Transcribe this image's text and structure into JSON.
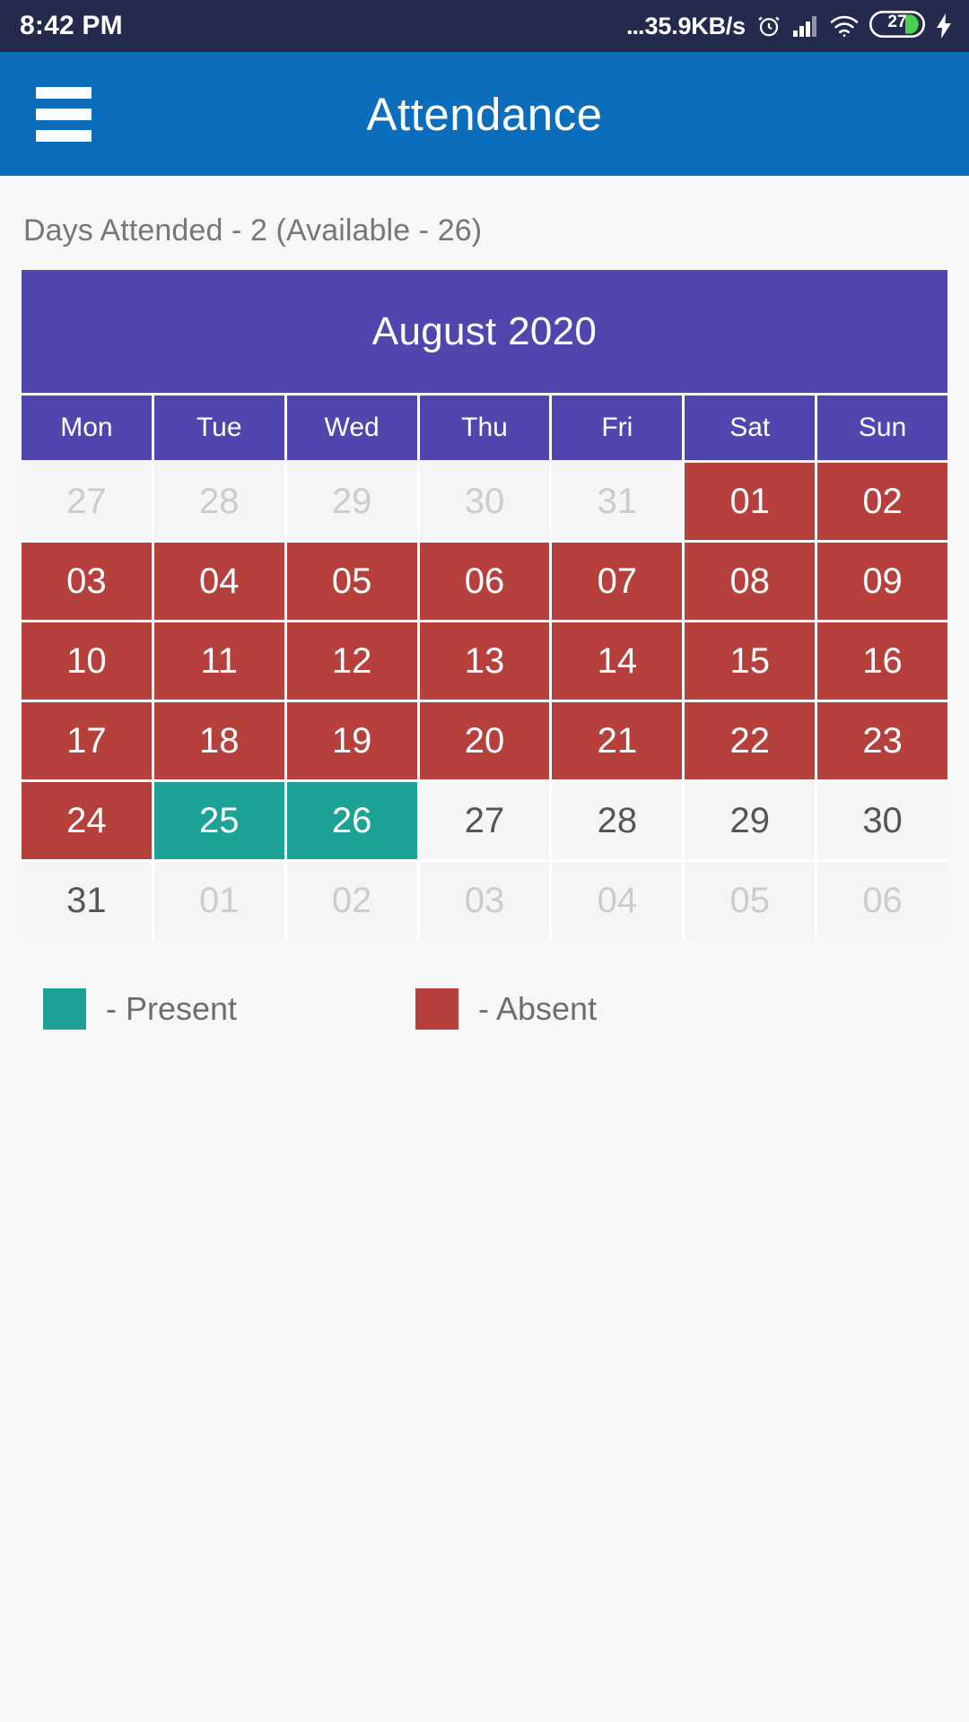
{
  "status_bar": {
    "time": "8:42 PM",
    "dots": "...",
    "network_speed": "35.9KB/s",
    "alarm_icon": "alarm-clock-icon",
    "signal_icon": "cellular-signal-icon",
    "wifi_icon": "wifi-icon",
    "battery_level": "27",
    "battery_icon": "battery-icon",
    "charging_icon": "charging-bolt-icon",
    "background": "#242a4d"
  },
  "app_bar": {
    "menu_icon": "hamburger-menu-icon",
    "title": "Attendance",
    "background": "#0a6ebd"
  },
  "summary": {
    "text": "Days Attended - 2 (Available - 26)"
  },
  "calendar": {
    "month_title": "August 2020",
    "header_color": "#5046ae",
    "weekdays": [
      "Mon",
      "Tue",
      "Wed",
      "Thu",
      "Fri",
      "Sat",
      "Sun"
    ],
    "weeks": [
      [
        {
          "label": "27",
          "state": "muted"
        },
        {
          "label": "28",
          "state": "muted"
        },
        {
          "label": "29",
          "state": "muted"
        },
        {
          "label": "30",
          "state": "muted"
        },
        {
          "label": "31",
          "state": "muted"
        },
        {
          "label": "01",
          "state": "absent"
        },
        {
          "label": "02",
          "state": "absent"
        }
      ],
      [
        {
          "label": "03",
          "state": "absent"
        },
        {
          "label": "04",
          "state": "absent"
        },
        {
          "label": "05",
          "state": "absent"
        },
        {
          "label": "06",
          "state": "absent"
        },
        {
          "label": "07",
          "state": "absent"
        },
        {
          "label": "08",
          "state": "absent"
        },
        {
          "label": "09",
          "state": "absent"
        }
      ],
      [
        {
          "label": "10",
          "state": "absent"
        },
        {
          "label": "11",
          "state": "absent"
        },
        {
          "label": "12",
          "state": "absent"
        },
        {
          "label": "13",
          "state": "absent"
        },
        {
          "label": "14",
          "state": "absent"
        },
        {
          "label": "15",
          "state": "absent"
        },
        {
          "label": "16",
          "state": "absent"
        }
      ],
      [
        {
          "label": "17",
          "state": "absent"
        },
        {
          "label": "18",
          "state": "absent"
        },
        {
          "label": "19",
          "state": "absent"
        },
        {
          "label": "20",
          "state": "absent"
        },
        {
          "label": "21",
          "state": "absent"
        },
        {
          "label": "22",
          "state": "absent"
        },
        {
          "label": "23",
          "state": "absent"
        }
      ],
      [
        {
          "label": "24",
          "state": "absent"
        },
        {
          "label": "25",
          "state": "present"
        },
        {
          "label": "26",
          "state": "present"
        },
        {
          "label": "27",
          "state": "plain"
        },
        {
          "label": "28",
          "state": "plain"
        },
        {
          "label": "29",
          "state": "plain"
        },
        {
          "label": "30",
          "state": "plain"
        }
      ],
      [
        {
          "label": "31",
          "state": "plain"
        },
        {
          "label": "01",
          "state": "muted"
        },
        {
          "label": "02",
          "state": "muted"
        },
        {
          "label": "03",
          "state": "muted"
        },
        {
          "label": "04",
          "state": "muted"
        },
        {
          "label": "05",
          "state": "muted"
        },
        {
          "label": "06",
          "state": "muted"
        }
      ]
    ]
  },
  "legend": {
    "items": [
      {
        "label": "- Present",
        "color": "#1da395",
        "state": "present"
      },
      {
        "label": "- Absent",
        "color": "#b5403c",
        "state": "absent"
      }
    ]
  },
  "colors": {
    "present": "#1da395",
    "absent": "#b5403c",
    "calendar_header": "#5046ae",
    "app_bar": "#0a6ebd",
    "status_bar": "#242a4d",
    "page_background": "#f7f7f7"
  }
}
